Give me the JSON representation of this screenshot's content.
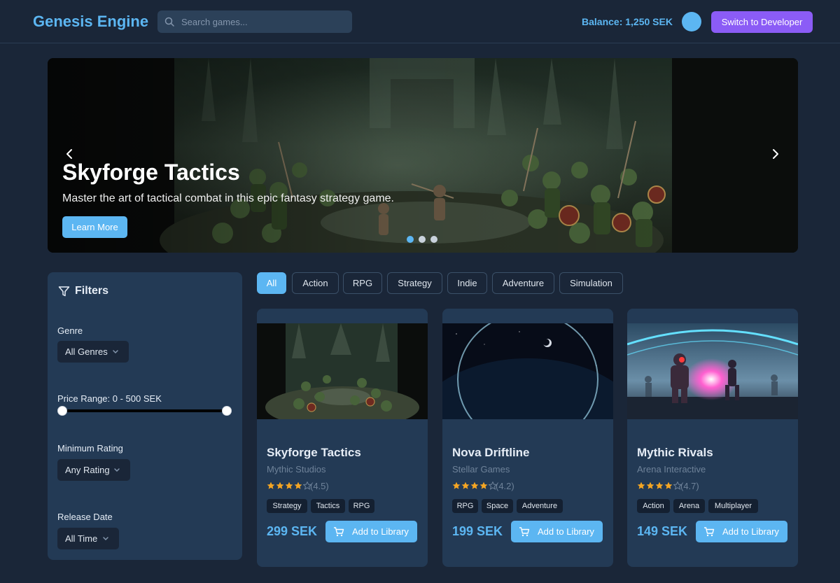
{
  "header": {
    "brand": "Genesis Engine",
    "search_placeholder": "Search games...",
    "balance": "Balance: 1,250 SEK",
    "switch_button": "Switch to Developer"
  },
  "hero": {
    "title": "Skyforge Tactics",
    "subtitle": "Master the art of tactical combat in this epic fantasy strategy game.",
    "cta": "Learn More",
    "prev_icon": "chevron-left-icon",
    "next_icon": "chevron-right-icon",
    "slides": 3,
    "active_slide": 1
  },
  "filters": {
    "title": "Filters",
    "icon": "filter-icon",
    "genre_label": "Genre",
    "genre_value": "All Genres",
    "price_label": "Price Range: 0 - 500 SEK",
    "price_min": 0,
    "price_max": 500,
    "rating_label": "Minimum Rating",
    "rating_value": "Any Rating",
    "release_label": "Release Date",
    "release_value": "All Time"
  },
  "tabs": [
    "All",
    "Action",
    "RPG",
    "Strategy",
    "Indie",
    "Adventure",
    "Simulation"
  ],
  "active_tab": "All",
  "games": [
    {
      "title": "Skyforge Tactics",
      "developer": "Mythic Studios",
      "stars": 4,
      "rating": "(4.5)",
      "tags": [
        "Strategy",
        "Tactics",
        "RPG"
      ],
      "price": "299 SEK",
      "button": "Add to Library"
    },
    {
      "title": "Nova Driftline",
      "developer": "Stellar Games",
      "stars": 4,
      "rating": "(4.2)",
      "tags": [
        "RPG",
        "Space",
        "Adventure"
      ],
      "price": "199 SEK",
      "button": "Add to Library"
    },
    {
      "title": "Mythic Rivals",
      "developer": "Arena Interactive",
      "stars": 4,
      "rating": "(4.7)",
      "tags": [
        "Action",
        "Arena",
        "Multiplayer"
      ],
      "price": "149 SEK",
      "button": "Add to Library"
    }
  ],
  "colors": {
    "background": "#1a2638",
    "panel": "#233a55",
    "accent": "#5cb6f2",
    "developer_button": "#8b5cf6",
    "star": "#f5a623"
  }
}
